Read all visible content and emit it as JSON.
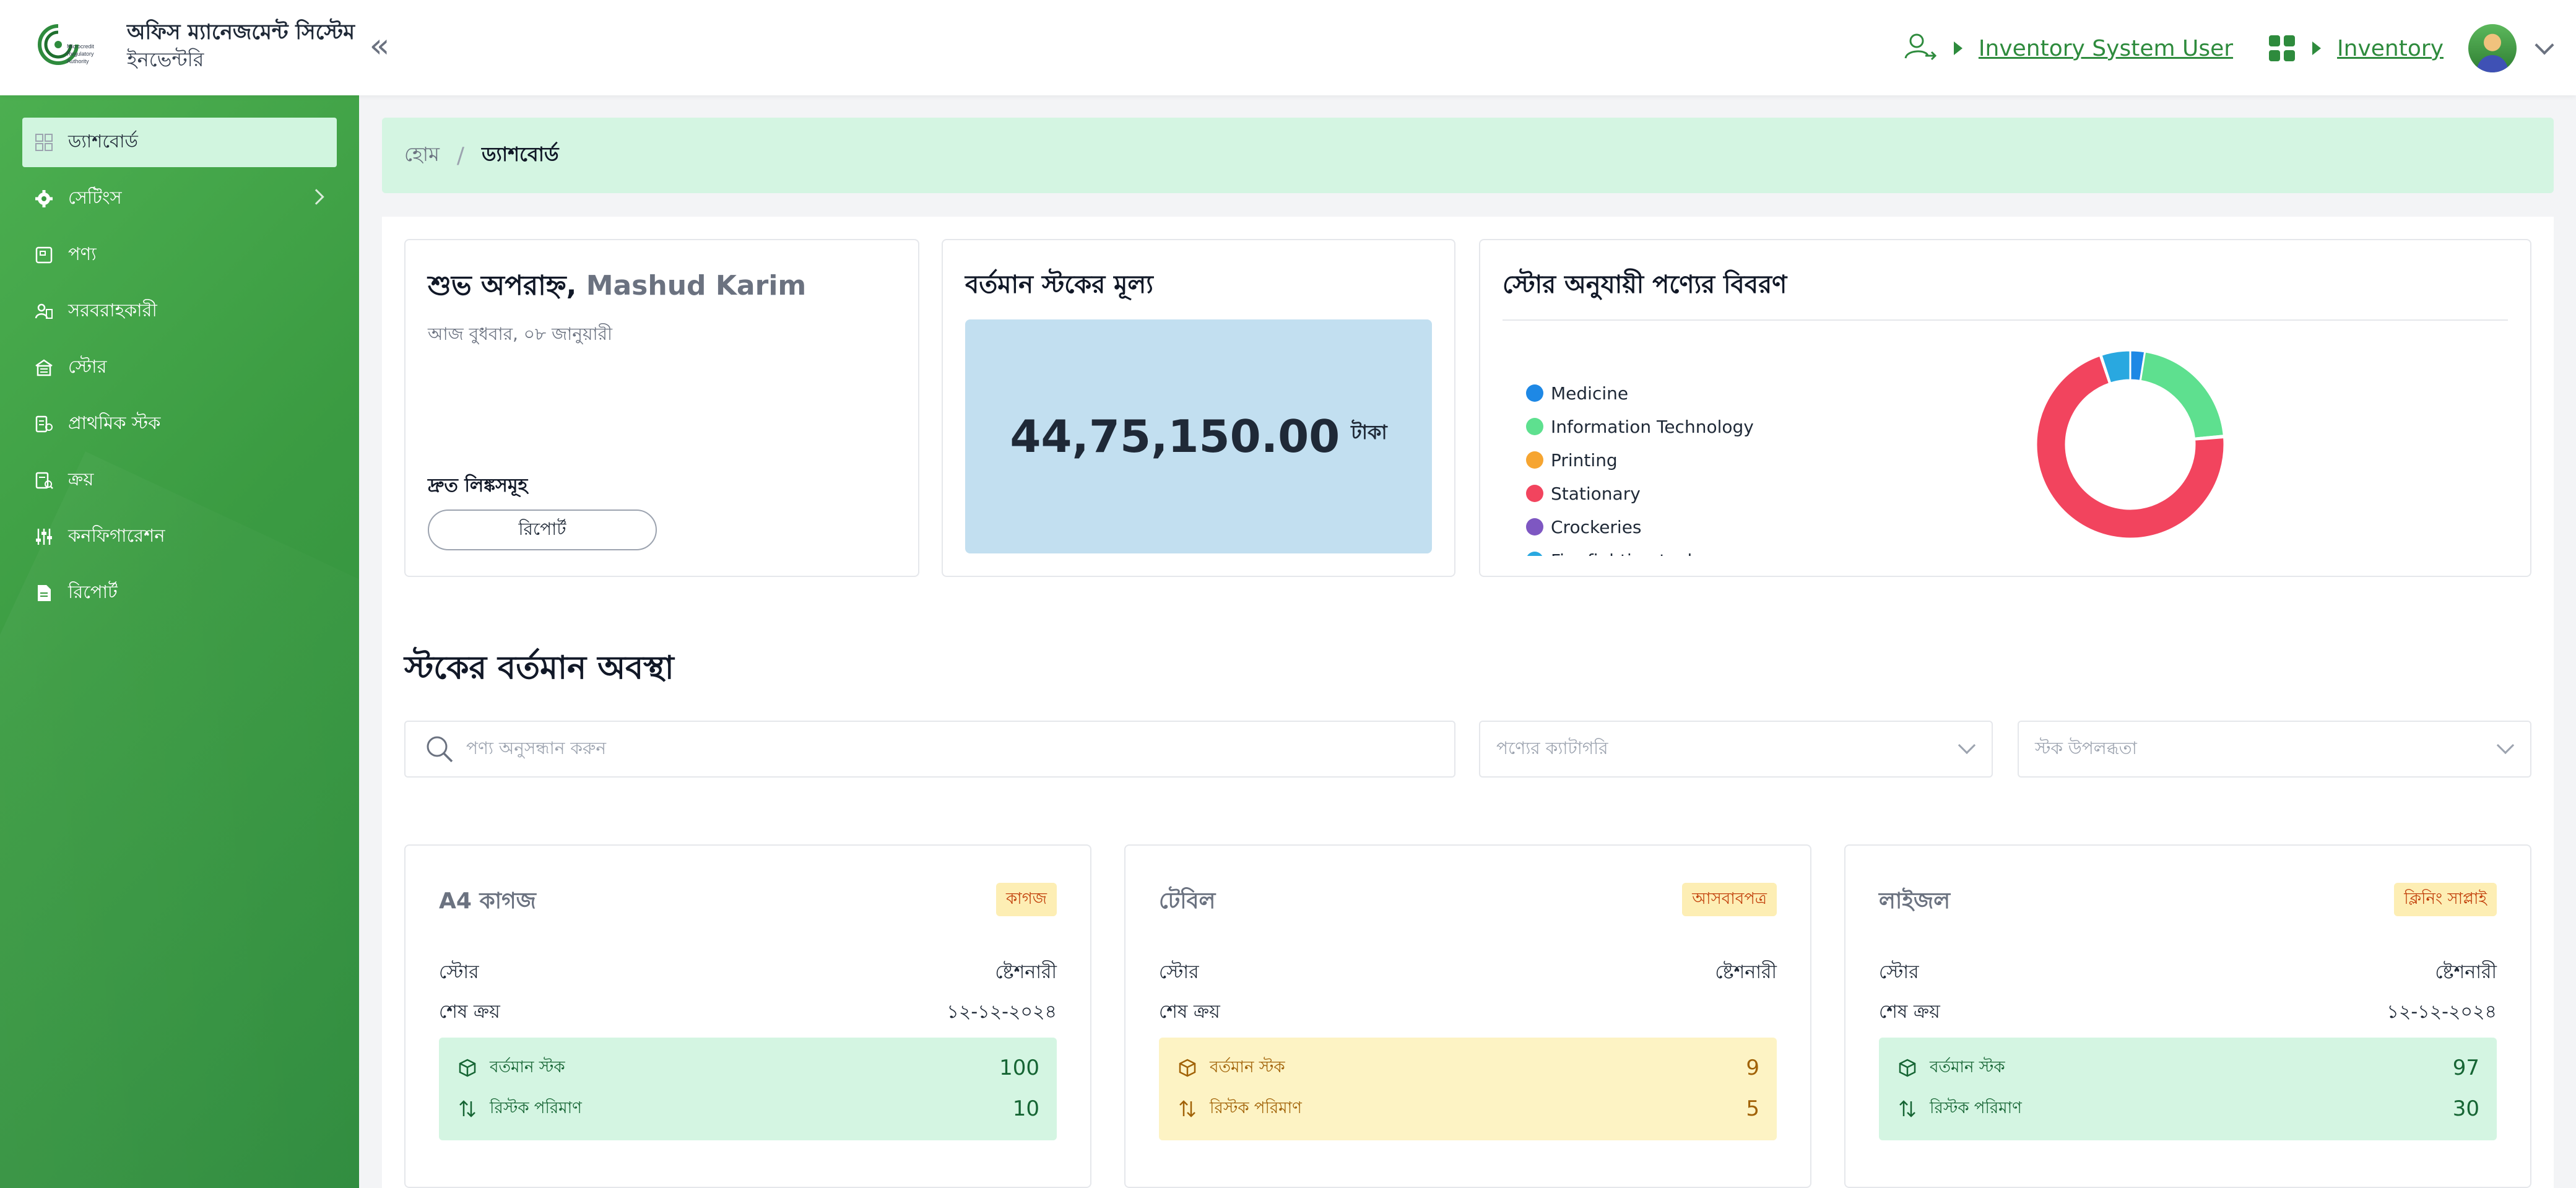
{
  "app": {
    "title": "অফিস ম্যানেজমেন্ট সিস্টেম",
    "subtitle": "ইনভেন্টরি",
    "logo_lines": [
      "Microcredit",
      "Regulatory",
      "Authority"
    ]
  },
  "header": {
    "user_role": "Inventory System User",
    "module": "Inventory",
    "collapse_glyph": "«"
  },
  "sidebar": {
    "items": [
      {
        "label": "ড্যাশবোর্ড",
        "icon": "dashboard-icon",
        "active": true
      },
      {
        "label": "সেটিংস",
        "icon": "gear-icon",
        "has_submenu": true
      },
      {
        "label": "পণ্য",
        "icon": "product-icon"
      },
      {
        "label": "সরবরাহকারী",
        "icon": "supplier-icon"
      },
      {
        "label": "স্টোর",
        "icon": "store-icon"
      },
      {
        "label": "প্রাথমিক স্টক",
        "icon": "initial-stock-icon"
      },
      {
        "label": "ক্রয়",
        "icon": "purchase-icon"
      },
      {
        "label": "কনফিগারেশন",
        "icon": "sliders-icon"
      },
      {
        "label": "রিপোর্ট",
        "icon": "report-icon"
      }
    ]
  },
  "breadcrumb": {
    "home": "হোম",
    "separator": "/",
    "current": "ড্যাশবোর্ড"
  },
  "greeting": {
    "title": "শুভ অপরাহ্ন,",
    "name": "Mashud Karim",
    "date": "আজ বুধবার, ০৮ জানুয়ারী",
    "quick_links_title": "দ্রুত লিঙ্কসমূহ",
    "quick_link_report": "রিপোর্ট"
  },
  "stock_value": {
    "title": "বর্তমান স্টকের মূল্য",
    "amount": "44,75,150.00",
    "unit": "টাকা"
  },
  "store_chart": {
    "title": "স্টোর অনুযায়ী পণ্যের বিবরণ",
    "legend": [
      {
        "name": "Medicine",
        "color": "#1e88e5"
      },
      {
        "name": "Information Technology",
        "color": "#5ee08f"
      },
      {
        "name": "Printing",
        "color": "#f6a531"
      },
      {
        "name": "Stationary",
        "color": "#f2445e"
      },
      {
        "name": "Crockeries",
        "color": "#7e57c2"
      },
      {
        "name": "Fire fighting tools",
        "color": "#29a8e0"
      }
    ]
  },
  "chart_data": {
    "type": "pie",
    "categories": [
      "Medicine",
      "Information Technology",
      "Printing",
      "Stationary",
      "Crockeries",
      "Fire fighting tools"
    ],
    "values": [
      2.5,
      21,
      0.3,
      71,
      0.2,
      5
    ],
    "colors": [
      "#1e88e5",
      "#5ee08f",
      "#f6a531",
      "#f2445e",
      "#7e57c2",
      "#29a8e0"
    ],
    "donut": true,
    "legend_position": "left"
  },
  "stock_section": {
    "title": "স্টকের বর্তমান অবস্থা",
    "search_placeholder": "পণ্য অনুসন্ধান করুন",
    "category_placeholder": "পণ্যের ক্যাটাগরি",
    "availability_placeholder": "স্টক উপলব্ধতা"
  },
  "products": [
    {
      "name": "A4 কাগজ",
      "category": "কাগজ",
      "store_label": "স্টোর",
      "store": "ষ্টেশনারী",
      "last_purchase_label": "শেষ ক্রয়",
      "last_purchase": "১২-১২-২০২৪",
      "current_stock_label": "বর্তমান স্টক",
      "current_stock": "100",
      "restock_label": "রিস্টক পরিমাণ",
      "restock": "10",
      "status_color": "#d4f5e2"
    },
    {
      "name": "টেবিল",
      "category": "আসবাবপত্র",
      "store_label": "স্টোর",
      "store": "ষ্টেশনারী",
      "last_purchase_label": "শেষ ক্রয়",
      "last_purchase": "",
      "current_stock_label": "বর্তমান স্টক",
      "current_stock": "9",
      "restock_label": "রিস্টক পরিমাণ",
      "restock": "5",
      "status_color": "#fdf3c4"
    },
    {
      "name": "লাইজল",
      "category": "ক্লিনিং সাপ্লাই",
      "store_label": "স্টোর",
      "store": "ষ্টেশনারী",
      "last_purchase_label": "শেষ ক্রয়",
      "last_purchase": "১২-১২-২০২৪",
      "current_stock_label": "বর্তমান স্টক",
      "current_stock": "97",
      "restock_label": "রিস্টক পরিমাণ",
      "restock": "30",
      "status_color": "#d4f5e2"
    }
  ]
}
